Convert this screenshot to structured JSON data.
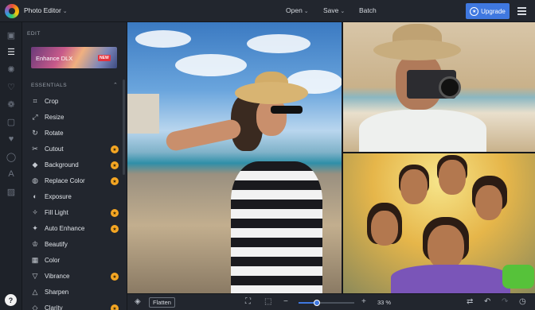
{
  "app": {
    "title": "Photo Editor"
  },
  "topmenu": {
    "open": "Open",
    "save": "Save",
    "batch": "Batch"
  },
  "upgrade": {
    "label": "Upgrade"
  },
  "panel": {
    "heading": "EDIT",
    "promo": {
      "label": "Enhance DLX",
      "badge": "NEW"
    },
    "section": "ESSENTIALS",
    "tools": [
      {
        "label": "Crop",
        "icon": "crop-icon",
        "pro": false
      },
      {
        "label": "Resize",
        "icon": "resize-icon",
        "pro": false
      },
      {
        "label": "Rotate",
        "icon": "rotate-icon",
        "pro": false
      },
      {
        "label": "Cutout",
        "icon": "scissors-icon",
        "pro": true
      },
      {
        "label": "Background",
        "icon": "background-icon",
        "pro": true
      },
      {
        "label": "Replace Color",
        "icon": "replace-color-icon",
        "pro": true
      },
      {
        "label": "Exposure",
        "icon": "exposure-icon",
        "pro": false
      },
      {
        "label": "Fill Light",
        "icon": "fill-light-icon",
        "pro": true
      },
      {
        "label": "Auto Enhance",
        "icon": "auto-enhance-icon",
        "pro": true
      },
      {
        "label": "Beautify",
        "icon": "beautify-icon",
        "pro": false
      },
      {
        "label": "Color",
        "icon": "color-icon",
        "pro": false
      },
      {
        "label": "Vibrance",
        "icon": "vibrance-icon",
        "pro": true
      },
      {
        "label": "Sharpen",
        "icon": "sharpen-icon",
        "pro": false
      },
      {
        "label": "Clarity",
        "icon": "clarity-icon",
        "pro": true
      }
    ]
  },
  "bottombar": {
    "flatten": "Flatten",
    "zoom_label": "33 %",
    "zoom_minus": "−",
    "zoom_plus": "+",
    "zoom_level": 0.33
  },
  "colors": {
    "accent": "#3f78e0",
    "pro_badge": "#f5a623",
    "new_badge": "#e2333f"
  }
}
